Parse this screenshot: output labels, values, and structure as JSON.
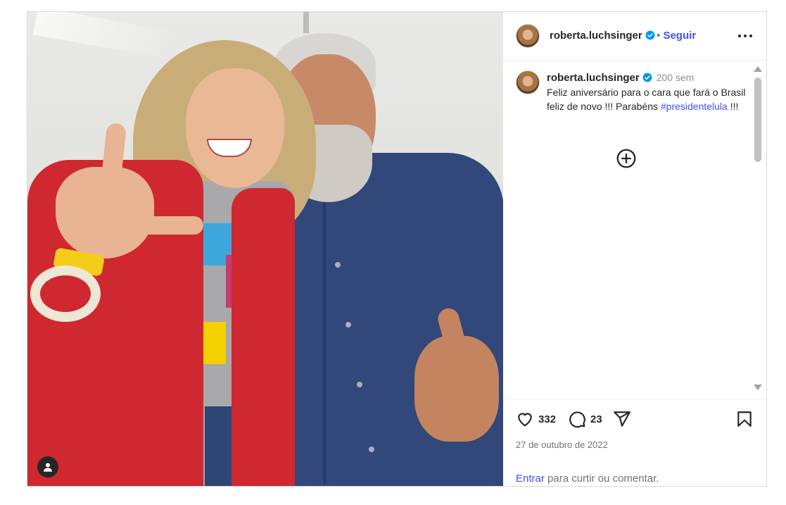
{
  "post": {
    "username": "roberta.luchsinger",
    "follow_separator": "•",
    "follow_label": "Seguir",
    "caption": {
      "username": "roberta.luchsinger",
      "time_ago": "200 sem",
      "text_before": "Feliz aniversário para o cara que fará o Brasil feliz de novo !!! Parabéns ",
      "hashtag": "#presidentelula",
      "text_after": " !!!"
    },
    "likes": "332",
    "comments": "23",
    "date": "27 de outubro de 2022",
    "login_link": "Entrar",
    "login_rest": " para curtir ou comentar."
  },
  "icons": {
    "verified": "verified-badge-icon",
    "more": "more-options-icon",
    "load_more": "plus-circle-icon",
    "like": "heart-icon",
    "comment": "comment-bubble-icon",
    "share": "paper-plane-icon",
    "save": "bookmark-icon",
    "tagged_user": "user-tag-icon"
  },
  "colors": {
    "link_blue": "#4150f7",
    "verified_blue": "#0095f6",
    "muted_text": "#737373"
  }
}
